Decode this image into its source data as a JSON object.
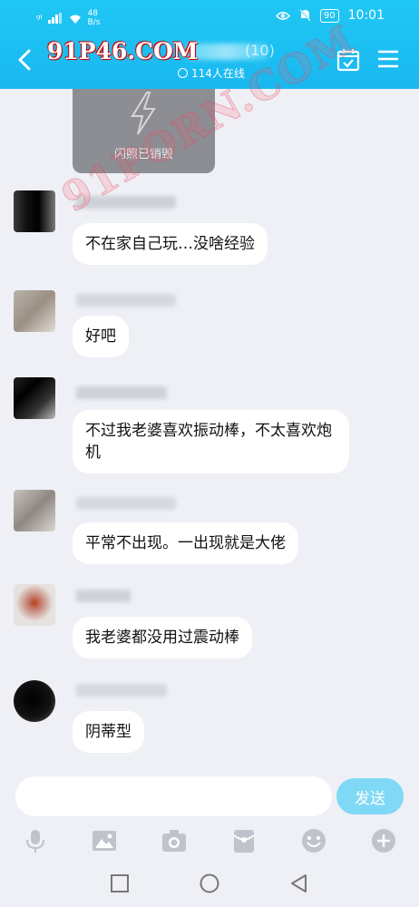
{
  "status_bar": {
    "carrier_signal": "ᵍᴵ",
    "net_speed_value": "48",
    "net_speed_unit": "B/s",
    "battery": "90",
    "time": "10:01"
  },
  "header": {
    "brand": "91P46.COM",
    "title_suffix": "(10)",
    "online_count": "114人在线"
  },
  "watermark": "91PORN.COM",
  "flash_card": {
    "label": "闪照已销毁"
  },
  "messages": [
    {
      "text": "不在家自己玩…没啥经验"
    },
    {
      "text": "好吧"
    },
    {
      "text": "不过我老婆喜欢振动棒，不太喜欢炮机"
    },
    {
      "text": "平常不出现。一出现就是大佬"
    },
    {
      "text": "我老婆都没用过震动棒"
    },
    {
      "text": "阴蒂型"
    }
  ],
  "input": {
    "placeholder": "",
    "send_label": "发送"
  },
  "colors": {
    "header": "#1cbff2",
    "send": "#7fd8f6",
    "background": "#eef0f6"
  },
  "icons": {
    "toolbar": [
      "microphone-icon",
      "image-icon",
      "camera-icon",
      "red-packet-icon",
      "emoji-icon",
      "plus-icon"
    ],
    "nav": [
      "recent-apps-icon",
      "home-icon",
      "back-icon"
    ]
  }
}
